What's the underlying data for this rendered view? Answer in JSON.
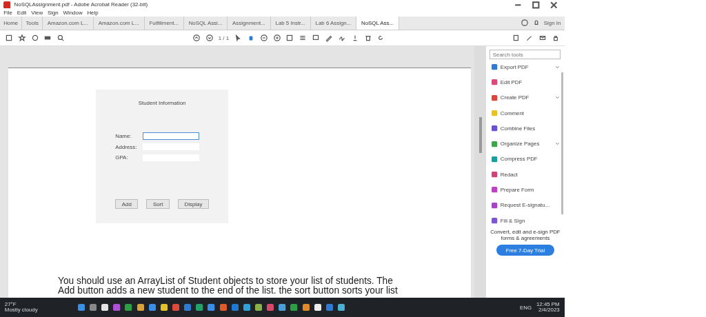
{
  "window": {
    "title": "NoSQLAssignment.pdf - Adobe Acrobat Reader (32-bit)"
  },
  "menu": [
    "File",
    "Edit",
    "View",
    "Sign",
    "Window",
    "Help"
  ],
  "tabs": [
    {
      "label": "Home",
      "selected": false
    },
    {
      "label": "Tools",
      "selected": false
    },
    {
      "label": "Amazon.com L...",
      "selected": false
    },
    {
      "label": "Amazon.com L...",
      "selected": false
    },
    {
      "label": "Fulfillment...",
      "selected": false
    },
    {
      "label": "NoSQL Assi...",
      "selected": false
    },
    {
      "label": "Assignment...",
      "selected": false
    },
    {
      "label": "Lab 5 Instr...",
      "selected": false
    },
    {
      "label": "Lab 6 Assign...",
      "selected": false
    },
    {
      "label": "NoSQL Ass...",
      "selected": true
    }
  ],
  "account": {
    "sign_in": "Sign In"
  },
  "toolbar": {
    "page_label": "1 / 1"
  },
  "form": {
    "title": "Student Information",
    "fields": [
      {
        "label": "Name:",
        "focused": true
      },
      {
        "label": "Address:",
        "focused": false
      },
      {
        "label": "GPA:",
        "focused": false
      }
    ],
    "buttons": [
      "Add",
      "Sort",
      "Display"
    ]
  },
  "document_text": [
    "You should use an ArrayList of Student objects to store your list of students. The",
    "Add button adds a new student to the end of the list. the sort button sorts your list"
  ],
  "tools_panel": {
    "search": {
      "placeholder": "Search tools"
    },
    "items": [
      {
        "label": "Export PDF",
        "color": "#2f7bd4",
        "dropdown": true
      },
      {
        "label": "Edit PDF",
        "color": "#e0457b",
        "dropdown": false
      },
      {
        "label": "Create PDF",
        "color": "#e0453a",
        "dropdown": true
      },
      {
        "label": "Comment",
        "color": "#e8c31e",
        "dropdown": false
      },
      {
        "label": "Combine Files",
        "color": "#6b4fd8",
        "dropdown": false
      },
      {
        "label": "Organize Pages",
        "color": "#38a84a",
        "dropdown": true
      },
      {
        "label": "Compress PDF",
        "color": "#1b9ea0",
        "dropdown": false
      },
      {
        "label": "Redact",
        "color": "#d2417a",
        "dropdown": false
      },
      {
        "label": "Prepare Form",
        "color": "#c03fc7",
        "dropdown": false
      },
      {
        "label": "Request E-signatu...",
        "color": "#a542c8",
        "dropdown": false
      },
      {
        "label": "Fill & Sign",
        "color": "#7b57d6",
        "dropdown": false
      }
    ],
    "promo": "Convert, edit and e-sign PDF forms & agreements",
    "trial_button": "Free 7-Day Trial"
  },
  "taskbar": {
    "weather_temp": "27°F",
    "weather_text": "Mostly cloudy",
    "lang": "ENG",
    "time": "12:45 PM",
    "date": "2/4/2023"
  }
}
